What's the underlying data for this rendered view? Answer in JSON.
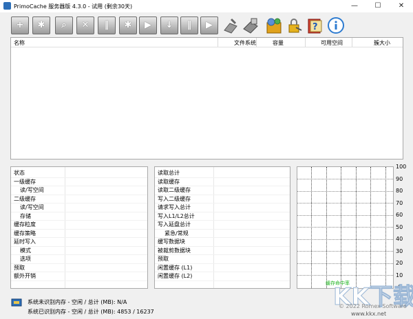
{
  "window": {
    "title": "PrimoCache 服务器版 4.3.0 - 试用 (剩余30天)",
    "minimize": "—",
    "maximize": "☐",
    "close": "✕"
  },
  "toolbar": {
    "buttons": [
      {
        "name": "add",
        "glyph": "+"
      },
      {
        "name": "settings",
        "glyph": "✱"
      },
      {
        "name": "search",
        "glyph": "⌕"
      },
      {
        "name": "delete",
        "glyph": "✕"
      },
      {
        "name": "pause",
        "glyph": "‖"
      },
      {
        "name": "flush",
        "glyph": "✱"
      },
      {
        "name": "play",
        "glyph": "▶"
      },
      {
        "name": "download",
        "glyph": "↓"
      },
      {
        "name": "pause2",
        "glyph": "‖"
      },
      {
        "name": "resume",
        "glyph": "▶"
      }
    ]
  },
  "volumes": {
    "headers": {
      "name": "名称",
      "fs": "文件系统",
      "capacity": "容量",
      "free": "可用空间",
      "block": "簇大小"
    }
  },
  "stats_left": {
    "rows": [
      "状态",
      "一级缓存",
      "读/写空间",
      "二级缓存",
      "读/写空间",
      "存储",
      "缓存粒度",
      "缓存策略",
      "延时写入",
      "模式",
      "选项",
      "预取",
      "额外开销"
    ]
  },
  "stats_mid": {
    "rows": [
      "读取总计",
      "读取缓存",
      "读取二级缓存",
      "写入二级缓存",
      "请求写入总计",
      "写入L1/L2总计",
      "写入延盘总计",
      "紧急/常规",
      "缓写数据块",
      "被裁剪数据块",
      "预取",
      "闲置缓存 (L1)",
      "闲置缓存 (L2)"
    ]
  },
  "graph": {
    "yticks": [
      "100",
      "90",
      "80",
      "70",
      "60",
      "50",
      "40",
      "30",
      "20",
      "10",
      "0"
    ],
    "legend": "缓存命中率",
    "y_range": [
      0,
      100
    ]
  },
  "status": {
    "line1": "系统未识别内存 - 空闲 / 总计 (MB):  N/A",
    "line2": "系统已识别内存 - 空闲 / 总计 (MB):  4853 / 16237"
  },
  "watermark": {
    "brand": "KK下载",
    "url": "www.kkx.net",
    "copyright": "© 2022 Romex Software"
  },
  "colors": {
    "legend_green": "#19b319",
    "brand_blue": "#2d6fb8"
  }
}
